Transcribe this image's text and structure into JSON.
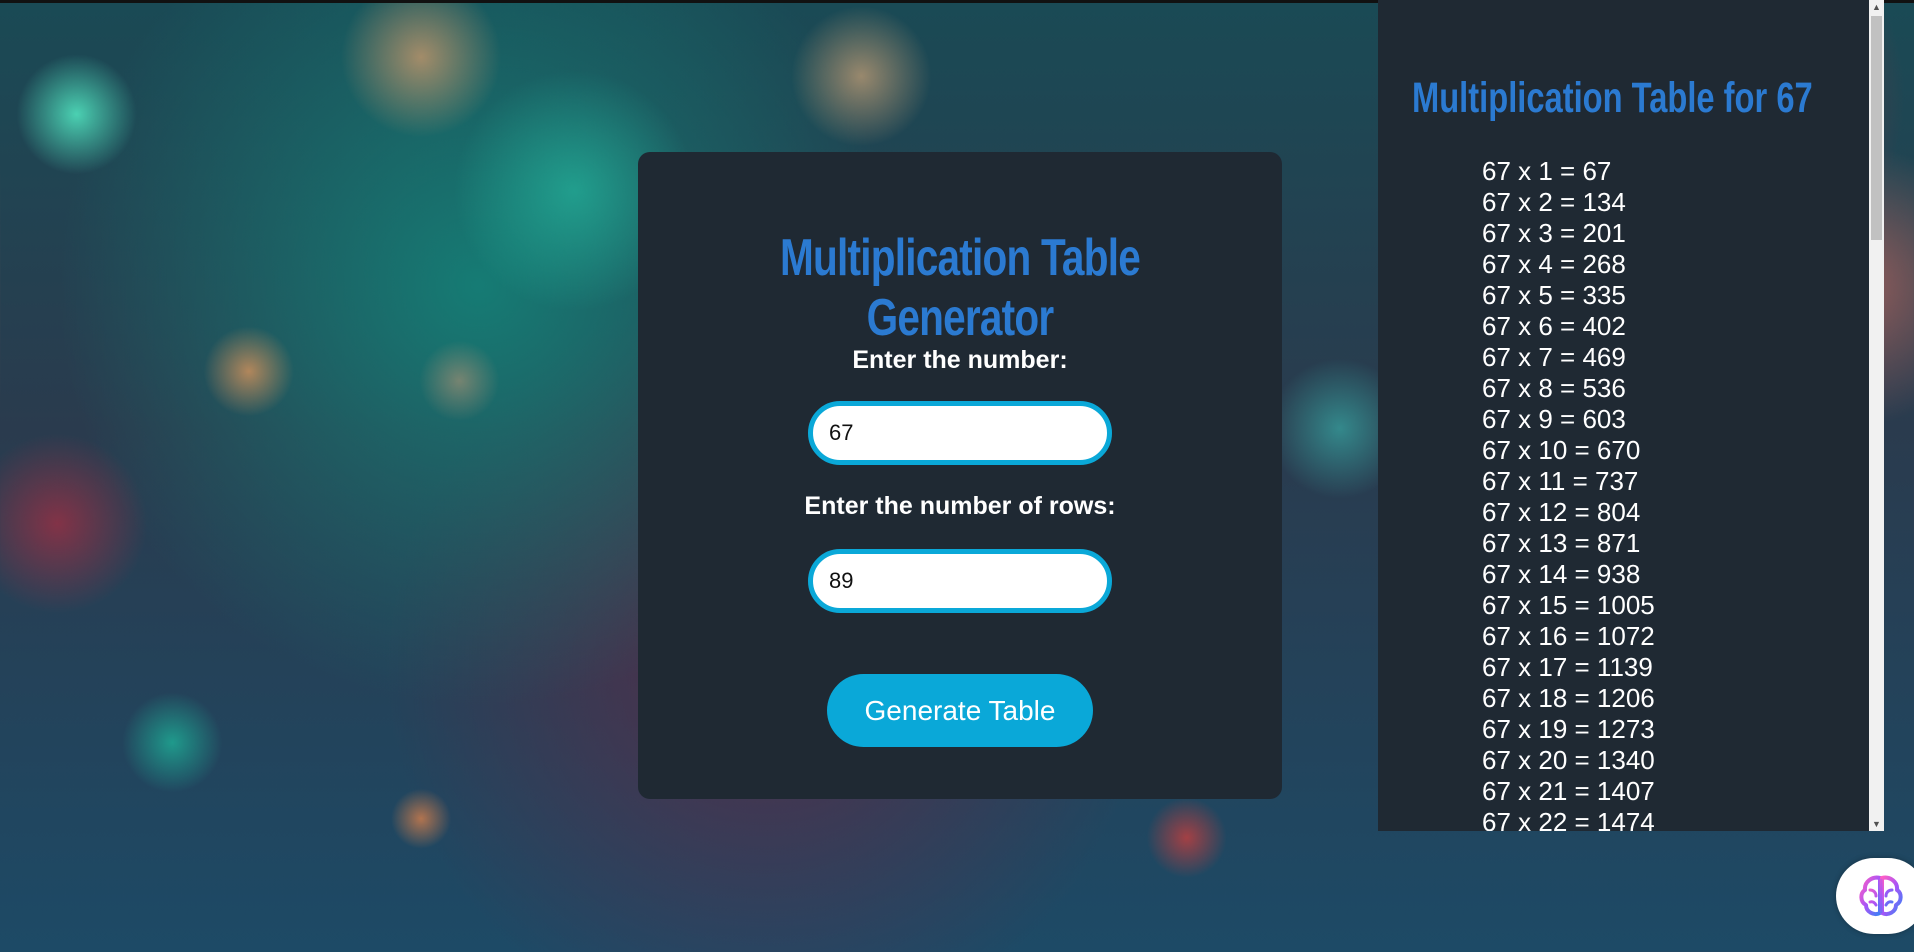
{
  "generator": {
    "title": "Multiplication Table Generator",
    "number_label": "Enter the number:",
    "number_value": "67",
    "rows_label": "Enter the number of rows:",
    "rows_value": "89",
    "generate_label": "Generate Table"
  },
  "result": {
    "title": "Multiplication Table for 67",
    "rows": [
      "67 x 1 = 67",
      "67 x 2 = 134",
      "67 x 3 = 201",
      "67 x 4 = 268",
      "67 x 5 = 335",
      "67 x 6 = 402",
      "67 x 7 = 469",
      "67 x 8 = 536",
      "67 x 9 = 603",
      "67 x 10 = 670",
      "67 x 11 = 737",
      "67 x 12 = 804",
      "67 x 13 = 871",
      "67 x 14 = 938",
      "67 x 15 = 1005",
      "67 x 16 = 1072",
      "67 x 17 = 1139",
      "67 x 18 = 1206",
      "67 x 19 = 1273",
      "67 x 20 = 1340",
      "67 x 21 = 1407",
      "67 x 22 = 1474"
    ]
  },
  "icons": {
    "scroll_up": "scroll-up-arrow-icon",
    "scroll_down": "scroll-down-arrow-icon",
    "extension": "brain-icon"
  },
  "colors": {
    "accent": "#0aa8d8",
    "title_blue": "#2b7ad1",
    "panel": "#1f2933"
  }
}
